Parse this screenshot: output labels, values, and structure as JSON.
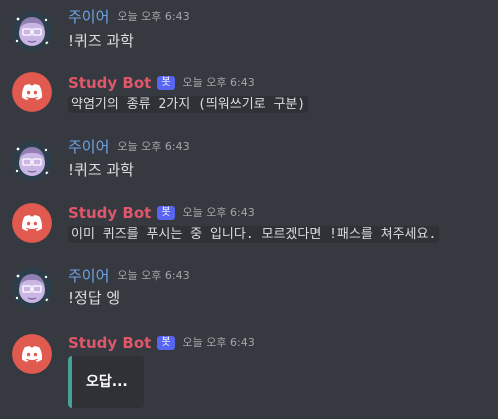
{
  "colors": {
    "background": "#36393f",
    "user_name": "#6fa3e6",
    "bot_name": "#e0576b",
    "bot_tag": "#5865f2",
    "timestamp": "#a3a6aa",
    "text": "#dcddde",
    "embed_bar": "#45a195",
    "embed_bg": "#2f3136",
    "bot_avatar": "#e05a4f"
  },
  "messages": [
    {
      "author": "주이어",
      "timestamp": "오늘 오후 6:43",
      "content": "!퀴즈 과학",
      "avatar_icon": "user-avatar-icon"
    },
    {
      "author": "Study Bot",
      "bot_tag": "봇",
      "timestamp": "오늘 오후 6:43",
      "content": "약염기의 종류 2가지 (띄워쓰기로 구분)",
      "avatar_icon": "discord-bot-avatar-icon"
    },
    {
      "author": "주이어",
      "timestamp": "오늘 오후 6:43",
      "content": "!퀴즈 과학",
      "avatar_icon": "user-avatar-icon"
    },
    {
      "author": "Study Bot",
      "bot_tag": "봇",
      "timestamp": "오늘 오후 6:43",
      "content": "이미 퀴즈를 푸시는 중 입니다. 모르겠다면 !패스를 쳐주세요.",
      "avatar_icon": "discord-bot-avatar-icon"
    },
    {
      "author": "주이어",
      "timestamp": "오늘 오후 6:43",
      "content": "!정답 엥",
      "avatar_icon": "user-avatar-icon"
    },
    {
      "author": "Study Bot",
      "bot_tag": "봇",
      "timestamp": "오늘 오후 6:43",
      "embed_title": "오답...",
      "avatar_icon": "discord-bot-avatar-icon"
    }
  ]
}
